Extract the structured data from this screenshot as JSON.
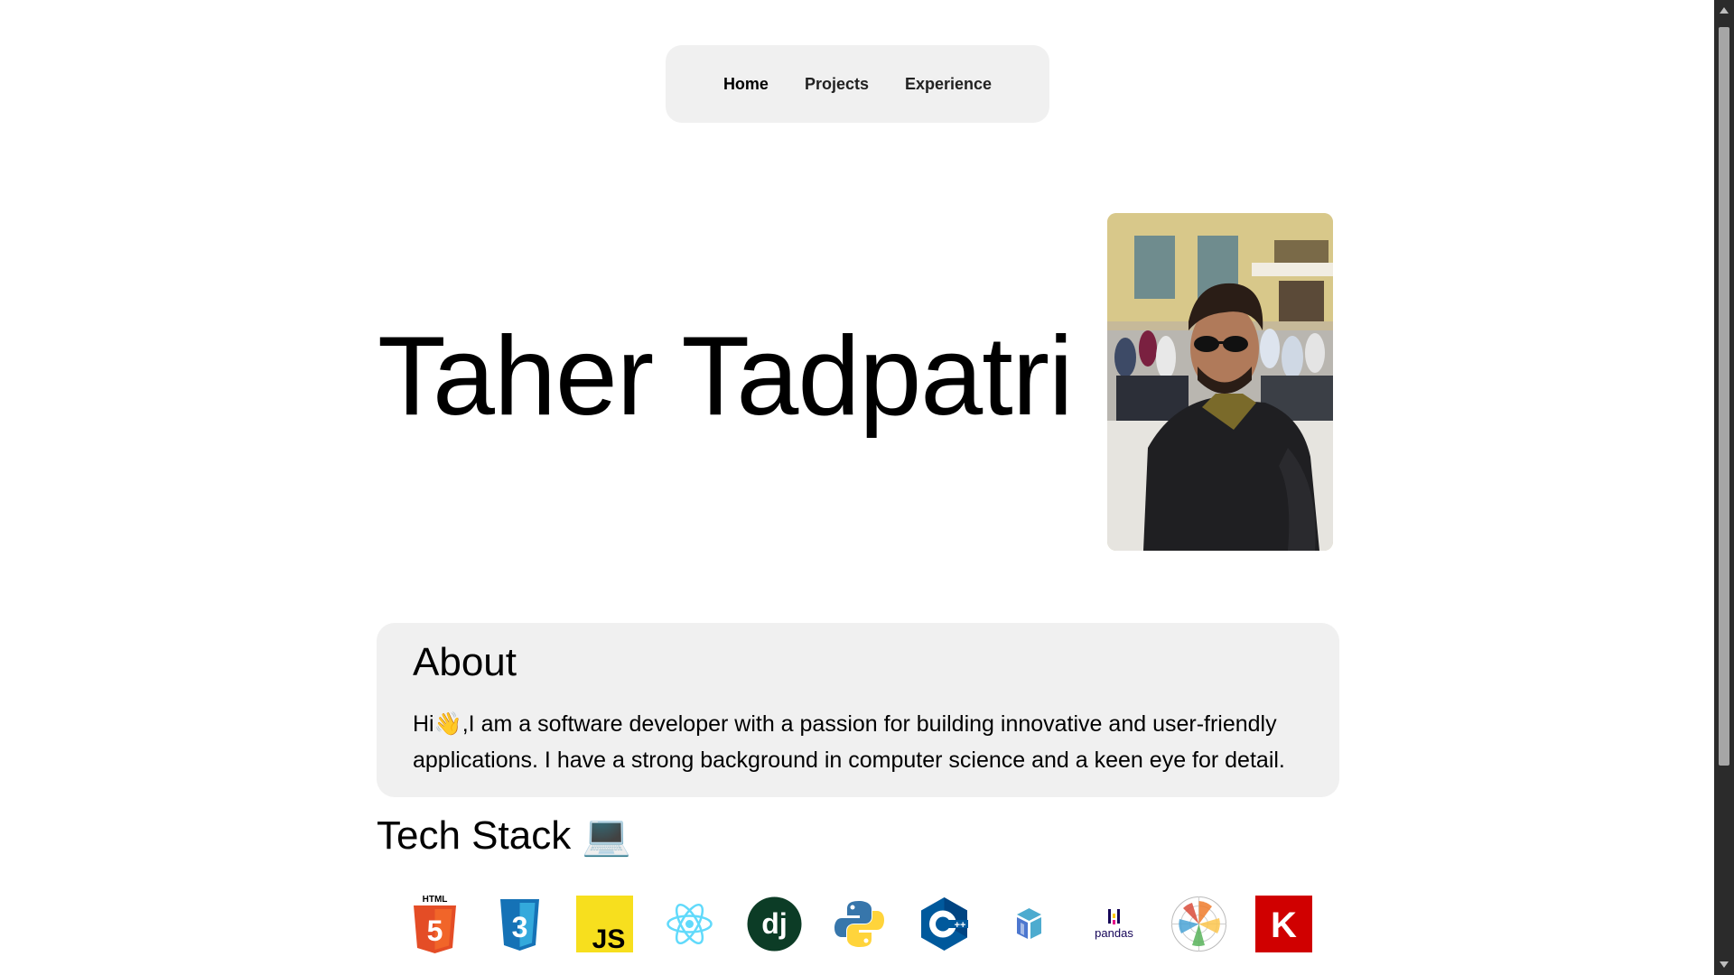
{
  "nav": {
    "items": [
      {
        "label": "Home",
        "active": true
      },
      {
        "label": "Projects",
        "active": false
      },
      {
        "label": "Experience",
        "active": false
      }
    ]
  },
  "hero": {
    "name": "Taher Tadpatri",
    "photo_icon": "profile-photo"
  },
  "about": {
    "title": "About",
    "text": "Hi👋,I am a software developer with a passion for building innovative and user-friendly applications. I have a strong background in computer science and a keen eye for detail."
  },
  "tech": {
    "title": "Tech Stack 💻",
    "icons": [
      {
        "name": "html5-icon",
        "label": "HTML",
        "color": "#e44d26"
      },
      {
        "name": "css3-icon",
        "label": "",
        "color": "#1572b6"
      },
      {
        "name": "javascript-icon",
        "label": "JS",
        "color": "#f7df1e"
      },
      {
        "name": "react-icon",
        "label": "",
        "color": "#61dafb"
      },
      {
        "name": "django-icon",
        "label": "dj",
        "color": "#0c3c26"
      },
      {
        "name": "python-icon",
        "label": "",
        "color": "#3776ab"
      },
      {
        "name": "cplusplus-icon",
        "label": "C++",
        "color": "#00599c"
      },
      {
        "name": "numpy-icon",
        "label": "",
        "color": "#4d77cf"
      },
      {
        "name": "pandas-icon",
        "label": "pandas",
        "color": "#150458"
      },
      {
        "name": "matplotlib-icon",
        "label": "",
        "color": "#11557c"
      },
      {
        "name": "keras-icon",
        "label": "K",
        "color": "#d00000"
      }
    ]
  },
  "colors": {
    "panel_bg": "#f0f0f0",
    "page_bg": "#ffffff",
    "text": "#000000"
  }
}
